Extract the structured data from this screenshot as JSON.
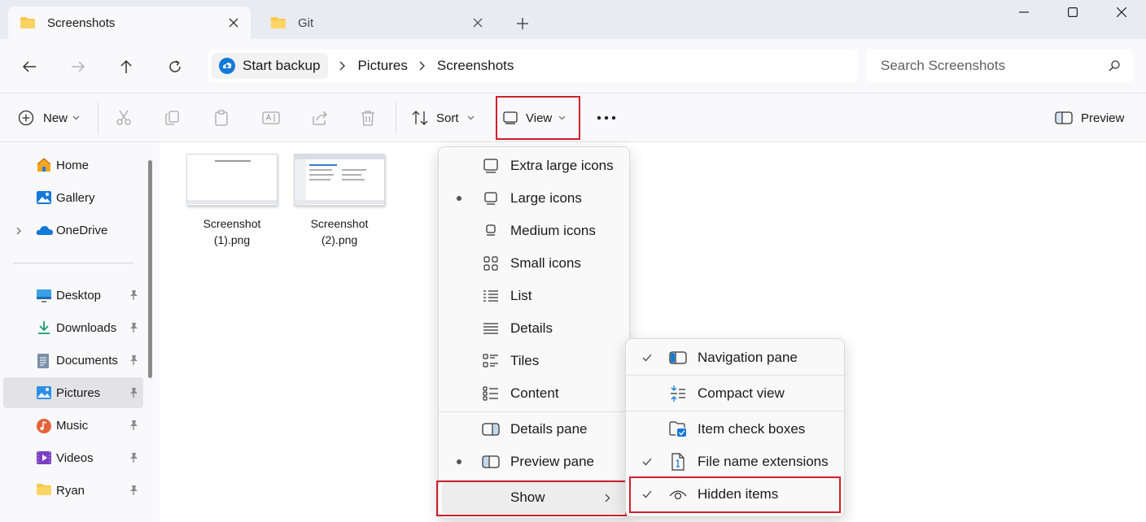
{
  "tabs": [
    {
      "label": "Screenshots",
      "active": true
    },
    {
      "label": "Git",
      "active": false
    }
  ],
  "address": {
    "backup_label": "Start backup",
    "crumbs": [
      "Pictures",
      "Screenshots"
    ]
  },
  "search": {
    "placeholder": "Search Screenshots"
  },
  "toolbar": {
    "new_label": "New",
    "sort_label": "Sort",
    "view_label": "View",
    "preview_label": "Preview"
  },
  "nav": {
    "items": [
      {
        "label": "Home"
      },
      {
        "label": "Gallery"
      },
      {
        "label": "OneDrive"
      },
      {
        "label": "Desktop"
      },
      {
        "label": "Downloads"
      },
      {
        "label": "Documents"
      },
      {
        "label": "Pictures"
      },
      {
        "label": "Music"
      },
      {
        "label": "Videos"
      },
      {
        "label": "Ryan"
      }
    ]
  },
  "files": [
    {
      "line1": "Screenshot",
      "line2": "(1).png"
    },
    {
      "line1": "Screenshot",
      "line2": "(2).png"
    }
  ],
  "view_menu": {
    "items": [
      {
        "label": "Extra large icons",
        "selected": false
      },
      {
        "label": "Large icons",
        "selected": true
      },
      {
        "label": "Medium icons",
        "selected": false
      },
      {
        "label": "Small icons",
        "selected": false
      },
      {
        "label": "List",
        "selected": false
      },
      {
        "label": "Details",
        "selected": false
      },
      {
        "label": "Tiles",
        "selected": false
      },
      {
        "label": "Content",
        "selected": false
      },
      {
        "label": "Details pane",
        "selected": false
      },
      {
        "label": "Preview pane",
        "selected": true
      },
      {
        "label": "Show",
        "selected": false
      }
    ]
  },
  "show_menu": {
    "items": [
      {
        "label": "Navigation pane",
        "checked": true
      },
      {
        "label": "Compact view",
        "checked": false
      },
      {
        "label": "Item check boxes",
        "checked": false
      },
      {
        "label": "File name extensions",
        "checked": true
      },
      {
        "label": "Hidden items",
        "checked": true
      }
    ]
  },
  "colors": {
    "accent": "#0067c0",
    "highlight_box": "#d0202d",
    "folder": "#f8c84c"
  }
}
